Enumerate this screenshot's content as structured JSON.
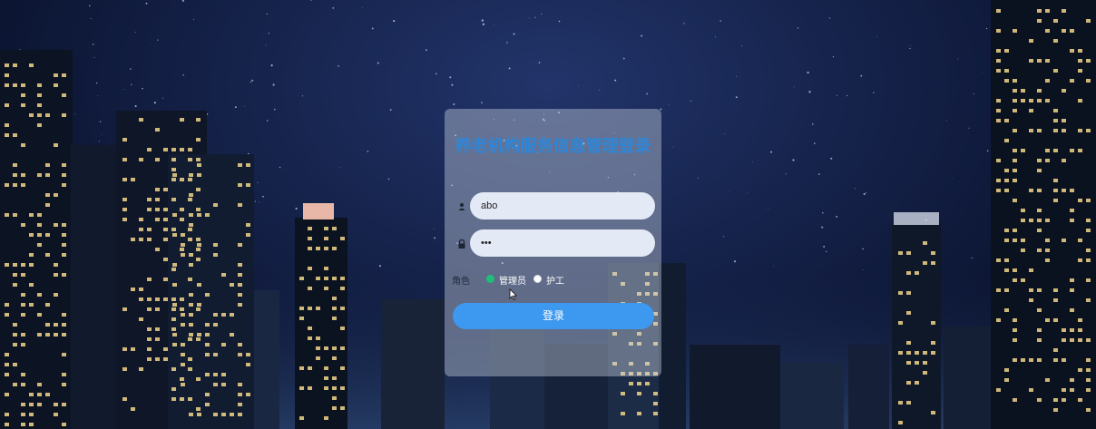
{
  "login": {
    "title": "养老机构服务信息管理登录",
    "username": {
      "value": "abo",
      "icon": "user-icon"
    },
    "password": {
      "value": "•••",
      "icon": "lock-icon"
    },
    "role": {
      "label": "角色",
      "options": [
        {
          "label": "管理员",
          "checked": true
        },
        {
          "label": "护工",
          "checked": false
        }
      ]
    },
    "submit_label": "登录"
  },
  "colors": {
    "title": "#2f86d6",
    "button": "#3d98f0",
    "radio_checked": "#1fbf7a",
    "input_bg": "#e4e9f6"
  }
}
